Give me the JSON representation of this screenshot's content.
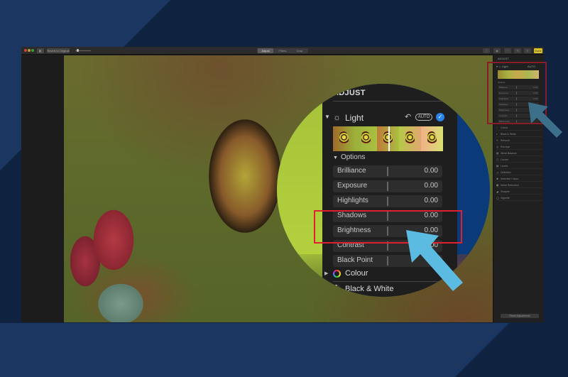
{
  "toolbar": {
    "sidebar_toggle": "◧",
    "revert_label": "Revert to Original",
    "zoom_min_icon": "●",
    "zoom_max_icon": "●",
    "tabs": [
      {
        "label": "Adjust",
        "active": true
      },
      {
        "label": "Filters",
        "active": false
      },
      {
        "label": "Crop",
        "active": false
      }
    ],
    "right_icons": [
      "info-icon",
      "favorite-icon",
      "heart-icon",
      "rotate-icon",
      "magic-wand-icon"
    ],
    "done_label": "Done"
  },
  "sidebar": {
    "title": "ADJUST",
    "light_label": "Light",
    "auto_label": "AUTO",
    "options_label": "Options",
    "options": [
      {
        "name": "Brilliance",
        "value": "0.00"
      },
      {
        "name": "Exposure",
        "value": "0.00"
      },
      {
        "name": "Highlights",
        "value": "0.00"
      },
      {
        "name": "Shadows",
        "value": ""
      },
      {
        "name": "Brightness",
        "value": ""
      },
      {
        "name": "Contrast",
        "value": ""
      },
      {
        "name": "Black Point",
        "value": ""
      }
    ],
    "sections": [
      {
        "label": "Colour",
        "icon": "◌"
      },
      {
        "label": "Black & White",
        "icon": "◐"
      },
      {
        "label": "Retouch",
        "icon": "✎"
      },
      {
        "label": "Red-eye",
        "icon": "◎"
      },
      {
        "label": "White Balance",
        "icon": "▨"
      },
      {
        "label": "Curves",
        "icon": "▢"
      },
      {
        "label": "Levels",
        "icon": "▤"
      },
      {
        "label": "Definition",
        "icon": "◿"
      },
      {
        "label": "Selective Colour",
        "icon": "✱"
      },
      {
        "label": "Noise Reduction",
        "icon": "▦"
      },
      {
        "label": "Sharpen",
        "icon": "◢"
      },
      {
        "label": "Vignette",
        "icon": "◯"
      }
    ],
    "reset_label": "Reset Adjustments"
  },
  "magnifier": {
    "title": "ADJUST",
    "light_label": "Light",
    "undo_icon": "↶",
    "auto_label": "AUTO",
    "check_icon": "✓",
    "options_label": "Options",
    "options": [
      {
        "name": "Brilliance",
        "value": "0.00"
      },
      {
        "name": "Exposure",
        "value": "0.00"
      },
      {
        "name": "Highlights",
        "value": "0.00"
      },
      {
        "name": "Shadows",
        "value": "0.00"
      },
      {
        "name": "Brightness",
        "value": "0.00"
      },
      {
        "name": "Contrast",
        "value": "0.00"
      },
      {
        "name": "Black Point",
        "value": ""
      }
    ],
    "colour_label": "Colour",
    "bw_label": "Black & White"
  },
  "colors": {
    "highlight_box": "#e0202e",
    "arrow_big": "#5bbbe0",
    "arrow_small": "#3b6f8a",
    "done_button": "#d8c22b",
    "check_blue": "#2a83e8"
  }
}
